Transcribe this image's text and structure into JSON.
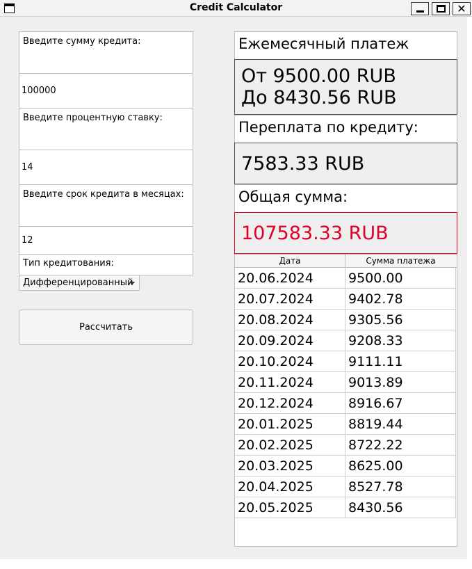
{
  "window": {
    "title": "Credit Calculator"
  },
  "form": {
    "amount_label": "Введите сумму кредита:",
    "amount_value": "100000",
    "rate_label": "Введите процентную ставку:",
    "rate_value": "14",
    "term_label": "Введите срок кредита в месяцах:",
    "term_value": "12",
    "type_label": "Тип кредитования:",
    "type_selected": "Дифференцированный",
    "calculate_label": "Рассчитать"
  },
  "results": {
    "monthly_label": "Ежемесячный платеж",
    "monthly_from": "От 9500.00 RUB",
    "monthly_to": "До 8430.56 RUB",
    "overpay_label": "Переплата по кредиту:",
    "overpay_value": "7583.33 RUB",
    "total_label": "Общая сумма:",
    "total_value": "107583.33 RUB",
    "total_color": "#e0002a"
  },
  "table": {
    "headers": [
      "Дата",
      "Сумма платежа"
    ],
    "rows": [
      [
        "20.06.2024",
        "9500.00"
      ],
      [
        "20.07.2024",
        "9402.78"
      ],
      [
        "20.08.2024",
        "9305.56"
      ],
      [
        "20.09.2024",
        "9208.33"
      ],
      [
        "20.10.2024",
        "9111.11"
      ],
      [
        "20.11.2024",
        "9013.89"
      ],
      [
        "20.12.2024",
        "8916.67"
      ],
      [
        "20.01.2025",
        "8819.44"
      ],
      [
        "20.02.2025",
        "8722.22"
      ],
      [
        "20.03.2025",
        "8625.00"
      ],
      [
        "20.04.2025",
        "8527.78"
      ],
      [
        "20.05.2025",
        "8430.56"
      ]
    ]
  }
}
